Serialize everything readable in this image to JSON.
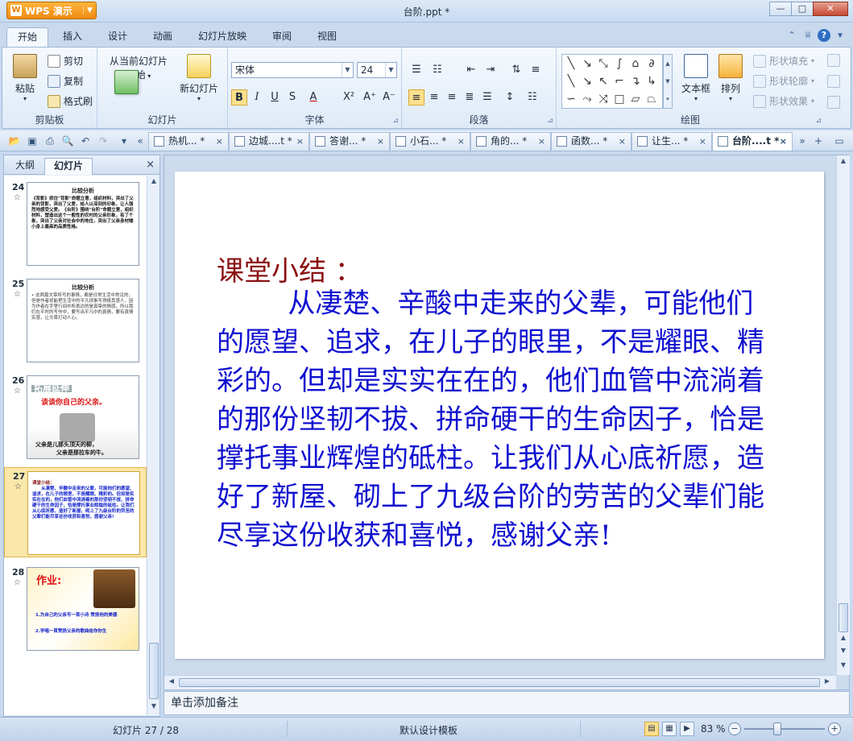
{
  "titlebar": {
    "app_name": "WPS 演示",
    "window_title": "台阶.ppt *",
    "minimize": "—",
    "maximize": "□",
    "close": "✕"
  },
  "ribbon_tabs": [
    "开始",
    "插入",
    "设计",
    "动画",
    "幻灯片放映",
    "审阅",
    "视图"
  ],
  "ribbon": {
    "clipboard": {
      "label": "剪贴板",
      "paste": "粘贴",
      "cut": "剪切",
      "copy": "复制",
      "format_painter": "格式刷"
    },
    "slides": {
      "label": "幻灯片",
      "from_current": "从当前幻灯片",
      "start": "开始",
      "new_slide": "新幻灯片"
    },
    "font": {
      "label": "字体",
      "font_name": "宋体",
      "font_size": "24"
    },
    "paragraph": {
      "label": "段落"
    },
    "drawing": {
      "label": "绘图",
      "textbox": "文本框",
      "arrange": "排列",
      "shape_fill": "形状填充",
      "shape_outline": "形状轮廓",
      "shape_effect": "形状效果"
    }
  },
  "doc_tabs": [
    {
      "label": "热机... *",
      "active": false
    },
    {
      "label": "边城....t *",
      "active": false
    },
    {
      "label": "答谢... *",
      "active": false
    },
    {
      "label": "小石... *",
      "active": false
    },
    {
      "label": "角的... *",
      "active": false
    },
    {
      "label": "函数... *",
      "active": false
    },
    {
      "label": "让生... *",
      "active": false
    },
    {
      "label": "台阶....t *",
      "active": true
    }
  ],
  "left_panel": {
    "tab_outline": "大纲",
    "tab_slides": "幻灯片",
    "close": "×",
    "thumbnails": [
      {
        "number": "24",
        "title": "比较分析",
        "text": "《背影》抓住\"背影\"命题立意，组织材料，突出了父亲的背影，突出了父爱，给人以深刻的印象，让人强烈地感受父爱。《台阶》围绕\"台阶\"命题立意，组织材料，塑造出这个一般性的农村的父亲形象，有了个象，突出了父亲对社会中的地位，突出了父亲身材矮小身上最高的品质性格。"
      },
      {
        "number": "25",
        "title": "比较分析",
        "text": "• 这两篇文章所写的事情，都是日常生活中常见的，但是作者却能把生活中的平凡琐事写得极其感人，因为作者在字里行间中所表达的是真挚的情感，所以我们在平时的写作中，要写出平凡中的真情，要有真情实感，让文章打动人心。"
      },
      {
        "number": "26",
        "heading": "拓展延伸",
        "prompt": "谈谈你自己的父亲。",
        "line1": "父亲是儿那头顶天的柳，",
        "line2": "父亲是那拉车的牛。"
      },
      {
        "number": "27",
        "title": "课堂小结："
      },
      {
        "number": "28",
        "heading": "作业:",
        "item1": "1.为自己的父亲写一首小诗 赞扬他的美德",
        "item2": "2.学唱一首赞扬父亲的歌曲给你你生"
      }
    ]
  },
  "slide": {
    "title": "课堂小结 ：",
    "body": "从凄楚、辛酸中走来的父辈，可能他们的愿望、追求，在儿子的眼里，不是耀眼、精彩的。但却是实实在在的，他们血管中流淌着的那份坚韧不拔、拼命硬干的生命因子，恰是撑托事业辉煌的砥柱。让我们从心底祈愿，造好了新屋、砌上了九级台阶的劳苦的父辈们能尽享这份收获和喜悦，感谢父亲!"
  },
  "notes_placeholder": "单击添加备注",
  "statusbar": {
    "slide_counter": "幻灯片 27 / 28",
    "template": "默认设计模板",
    "zoom": "83 %",
    "zoom_fraction": 0.83
  }
}
